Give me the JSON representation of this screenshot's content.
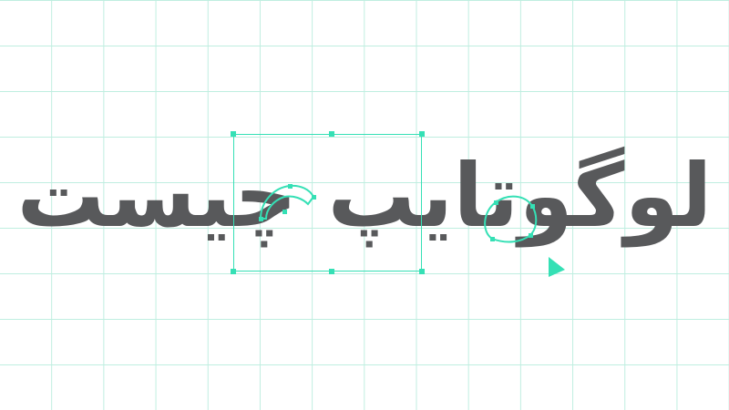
{
  "headline": {
    "text": "لوگوتایپ چیست"
  },
  "colors": {
    "grid": "#bfeee0",
    "accent": "#35e0b5",
    "text": "#58595b",
    "background": "#ffffff"
  },
  "icons": {
    "cursor": "direct-selection-arrow-icon"
  }
}
